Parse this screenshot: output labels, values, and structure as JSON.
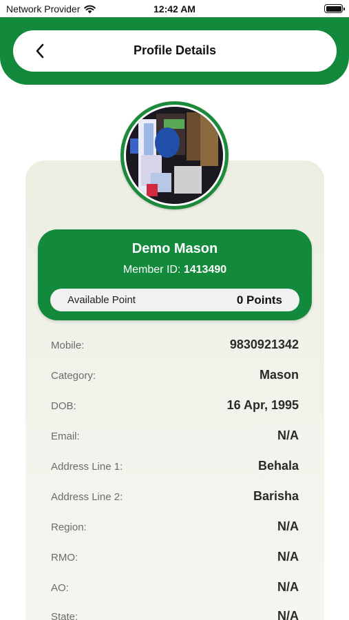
{
  "status_bar": {
    "carrier": "Network Provider",
    "time": "12:42 AM"
  },
  "header": {
    "title": "Profile Details"
  },
  "profile": {
    "name": "Demo Mason",
    "member_id_label": "Member ID:",
    "member_id": "1413490",
    "points_label": "Available Point",
    "points_value": "0 Points"
  },
  "details": [
    {
      "label": "Mobile:",
      "value": "9830921342"
    },
    {
      "label": "Category:",
      "value": "Mason"
    },
    {
      "label": "DOB:",
      "value": "16 Apr, 1995"
    },
    {
      "label": "Email:",
      "value": "N/A"
    },
    {
      "label": "Address Line 1:",
      "value": "Behala"
    },
    {
      "label": "Address Line 2:",
      "value": "Barisha"
    },
    {
      "label": "Region:",
      "value": "N/A"
    },
    {
      "label": "RMO:",
      "value": "N/A"
    },
    {
      "label": "AO:",
      "value": "N/A"
    },
    {
      "label": "State:",
      "value": "N/A"
    }
  ],
  "colors": {
    "brand_green": "#138a3b",
    "card_bg": "#f1f2ea"
  },
  "icons": [
    "wifi-icon",
    "battery-icon",
    "back-arrow-icon",
    "avatar-photo"
  ]
}
